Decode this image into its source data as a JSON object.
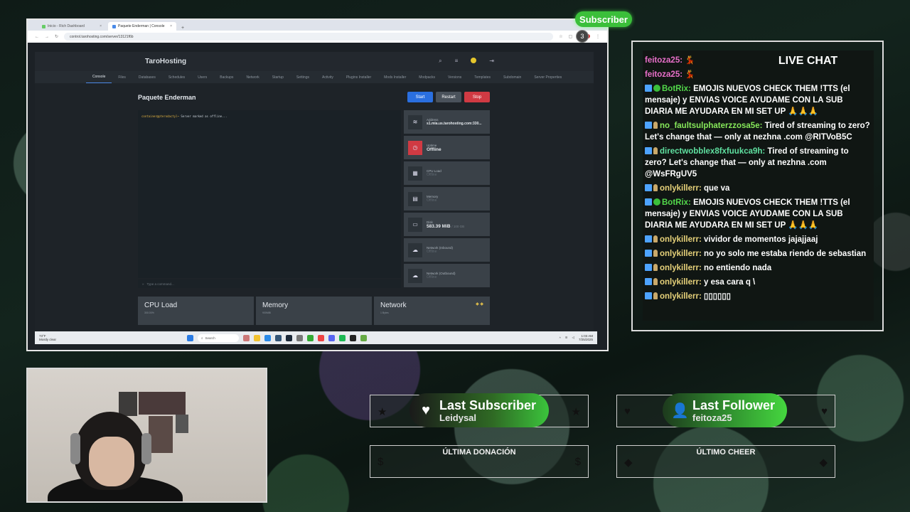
{
  "browser": {
    "tabs": [
      {
        "label": "Inicio - Rich Dashboard"
      },
      {
        "label": "Paquete Enderman | Console"
      }
    ],
    "new_tab": "+",
    "url": "control.tarohosting.com/server/13121f6b"
  },
  "panel": {
    "logo": "TaroHosting",
    "nav": [
      "Console",
      "Files",
      "Databases",
      "Schedules",
      "Users",
      "Backups",
      "Network",
      "Startup",
      "Settings",
      "Activity",
      "Plugins Installer",
      "Mods Installer",
      "Modpacks",
      "Versions",
      "Templates",
      "Subdomain",
      "Server Properties"
    ],
    "server_name": "Paquete Enderman",
    "buttons": {
      "start": "Start",
      "restart": "Restart",
      "stop": "Stop"
    },
    "console_line_prompt": "container@pterodactyl~",
    "console_line_text": " Server marked as offline...",
    "console_placeholder": "Type a command...",
    "stats": [
      {
        "label": "Address",
        "value": "s1.mia.us.tarohosting.com:330..."
      },
      {
        "label": "Uptime",
        "value": "Offline"
      },
      {
        "label": "CPU Load",
        "value": "Offline"
      },
      {
        "label": "Memory",
        "value": "Offline"
      },
      {
        "label": "Disk",
        "value": "583.39 MiB",
        "sub": "/ 100 GB"
      },
      {
        "label": "Network (Inbound)",
        "value": "Offline"
      },
      {
        "label": "Network (Outbound)",
        "value": "Offline"
      }
    ],
    "graphs": [
      {
        "title": "CPU Load",
        "sub": "300.00%"
      },
      {
        "title": "Memory",
        "sub": "900MiB"
      },
      {
        "title": "Network",
        "sub": "1 Bytes"
      }
    ]
  },
  "taskbar": {
    "weather_temp": "73°F",
    "weather_desc": "Mostly clear",
    "search": "Search",
    "time": "1:03 AM",
    "date": "7/25/2025"
  },
  "overlay": {
    "subscriber_badge": "Subscriber",
    "notif_count": "3",
    "chat_title": "LIVE CHAT",
    "chat": [
      {
        "name": "feitoza25:",
        "text": " 💃",
        "color": "#e86fc9"
      },
      {
        "name": "feitoza25:",
        "text": " 💃",
        "color": "#e86fc9"
      },
      {
        "name": "BotRix:",
        "text": " EMOJIS NUEVOS CHECK THEM !TTS (el mensaje) y ENVIAS VOICE AYUDAME CON LA SUB DIARIA ME AYUDARA EN MI SET UP 🙏🙏🙏",
        "color": "#53d94b"
      },
      {
        "name": "no_faultsulphaterzzosa5e:",
        "text": " Tired of streaming to zero? Let's change that — only at nezhna .com @RITVoB5C",
        "color": "#86e85a"
      },
      {
        "name": "directwobblex8fxfuukca9h:",
        "text": " Tired of streaming to zero? Let's change that — only at nezhna .com @WsFRgUV5",
        "color": "#5fe0a0"
      },
      {
        "name": "onlykillerr:",
        "text": " que va",
        "color": "#e7d27a"
      },
      {
        "name": "BotRix:",
        "text": " EMOJIS NUEVOS CHECK THEM !TTS (el mensaje) y ENVIAS VOICE AYUDAME CON LA SUB DIARIA ME AYUDARA EN MI SET UP 🙏🙏🙏",
        "color": "#53d94b"
      },
      {
        "name": "onlykillerr:",
        "text": " vividor de momentos jajajjaaj",
        "color": "#e7d27a"
      },
      {
        "name": "onlykillerr:",
        "text": " no yo solo me estaba riendo de sebastian",
        "color": "#e7d27a"
      },
      {
        "name": "onlykillerr:",
        "text": " no entiendo nada",
        "color": "#e7d27a"
      },
      {
        "name": "onlykillerr:",
        "text": " y esa cara q \\",
        "color": "#e7d27a"
      },
      {
        "name": "onlykillerr:",
        "text": " ▯▯▯▯▯▯",
        "color": "#e7d27a"
      }
    ],
    "last_subscriber_title": "Last Subscriber",
    "last_subscriber_name": "Leidysal",
    "last_follower_title": "Last Follower",
    "last_follower_name": "feitoza25",
    "donation_label": "ÚLTIMA DONACIÓN",
    "cheer_label": "ÚLTIMO CHEER",
    "colors": {
      "accent_green": "#3bbf3a",
      "start_blue": "#2a6fe0",
      "stop_red": "#d03a43"
    }
  }
}
